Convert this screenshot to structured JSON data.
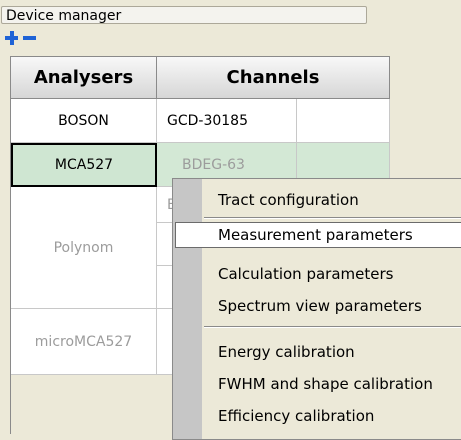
{
  "panel": {
    "title": "Device manager"
  },
  "toolbar": {
    "add_icon": "plus-icon",
    "remove_icon": "minus-icon",
    "accent": "#1f63d6"
  },
  "table": {
    "headers": [
      "Analysers",
      "Channels"
    ],
    "rows": [
      {
        "analyser": "BOSON",
        "channels": [
          "GCD-30185"
        ]
      },
      {
        "analyser": "MCA527",
        "channels": [
          "BDEG-63"
        ],
        "selected": true
      },
      {
        "analyser": "Polynom",
        "channels": [
          "B"
        ]
      },
      {
        "analyser": "microMCA527",
        "channels": []
      }
    ]
  },
  "context_menu": {
    "items": [
      "Tract configuration",
      "Measurement parameters",
      "Calculation parameters",
      "Spectrum view parameters",
      "Energy calibration",
      "FWHM and shape calibration",
      "Efficiency calibration"
    ],
    "highlighted": "Measurement parameters"
  }
}
